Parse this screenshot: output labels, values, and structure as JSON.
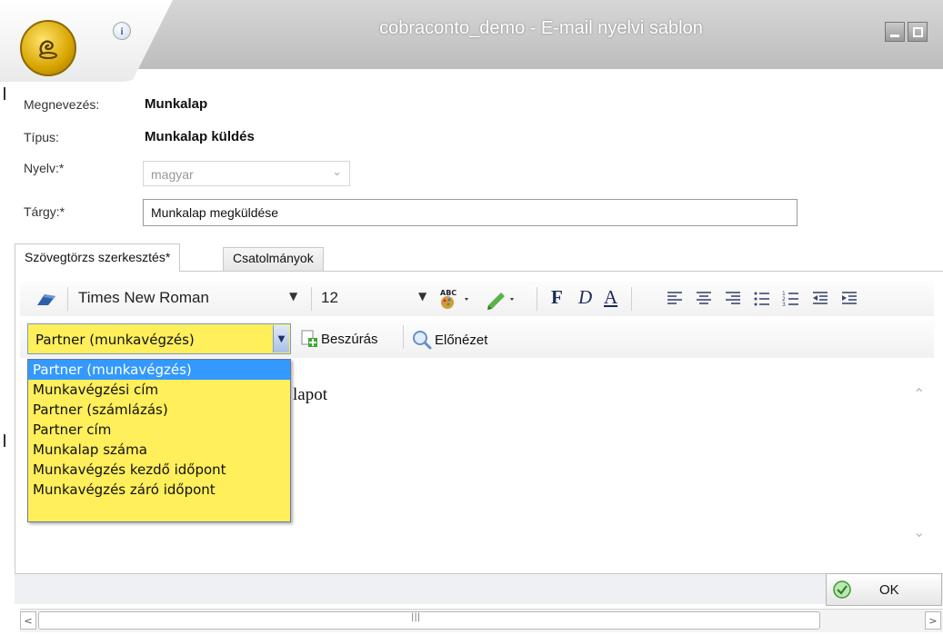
{
  "window": {
    "title": "cobraconto_demo - E-mail nyelvi sablon",
    "info_glyph": "i"
  },
  "form": {
    "name_label": "Megnevezés:",
    "name_value": "Munkalap",
    "type_label": "Típus:",
    "type_value": "Munkalap küldés",
    "language_label": "Nyelv:*",
    "language_value": "magyar",
    "subject_label": "Tárgy:*",
    "subject_value": "Munkalap megküldése"
  },
  "tabs": [
    {
      "label": "Szövegtörzs szerkesztés*",
      "active": true
    },
    {
      "label": "Csatolmányok",
      "active": false
    }
  ],
  "editor": {
    "font_name": "Times New Roman",
    "font_size": "12",
    "bold_glyph": "F",
    "italic_glyph": "D",
    "underline_glyph": "A",
    "field_selected": "Partner (munkavégzés)",
    "insert_label": "Beszúrás",
    "preview_label": "Előnézet",
    "body_text_visible": "lapot"
  },
  "dropdown": {
    "options": [
      "Partner (munkavégzés)",
      "Munkavégzési cím",
      "Partner (számlázás)",
      "Partner cím",
      "Munkalap száma",
      "Munkavégzés kezdő időpont",
      "Munkavégzés záró időpont"
    ],
    "selected_index": 0
  },
  "footer": {
    "ok_label": "OK"
  },
  "colors": {
    "dropdown_bg": "#ffef5a",
    "selection": "#3399ff",
    "ok_icon": "#3a9a3a"
  }
}
